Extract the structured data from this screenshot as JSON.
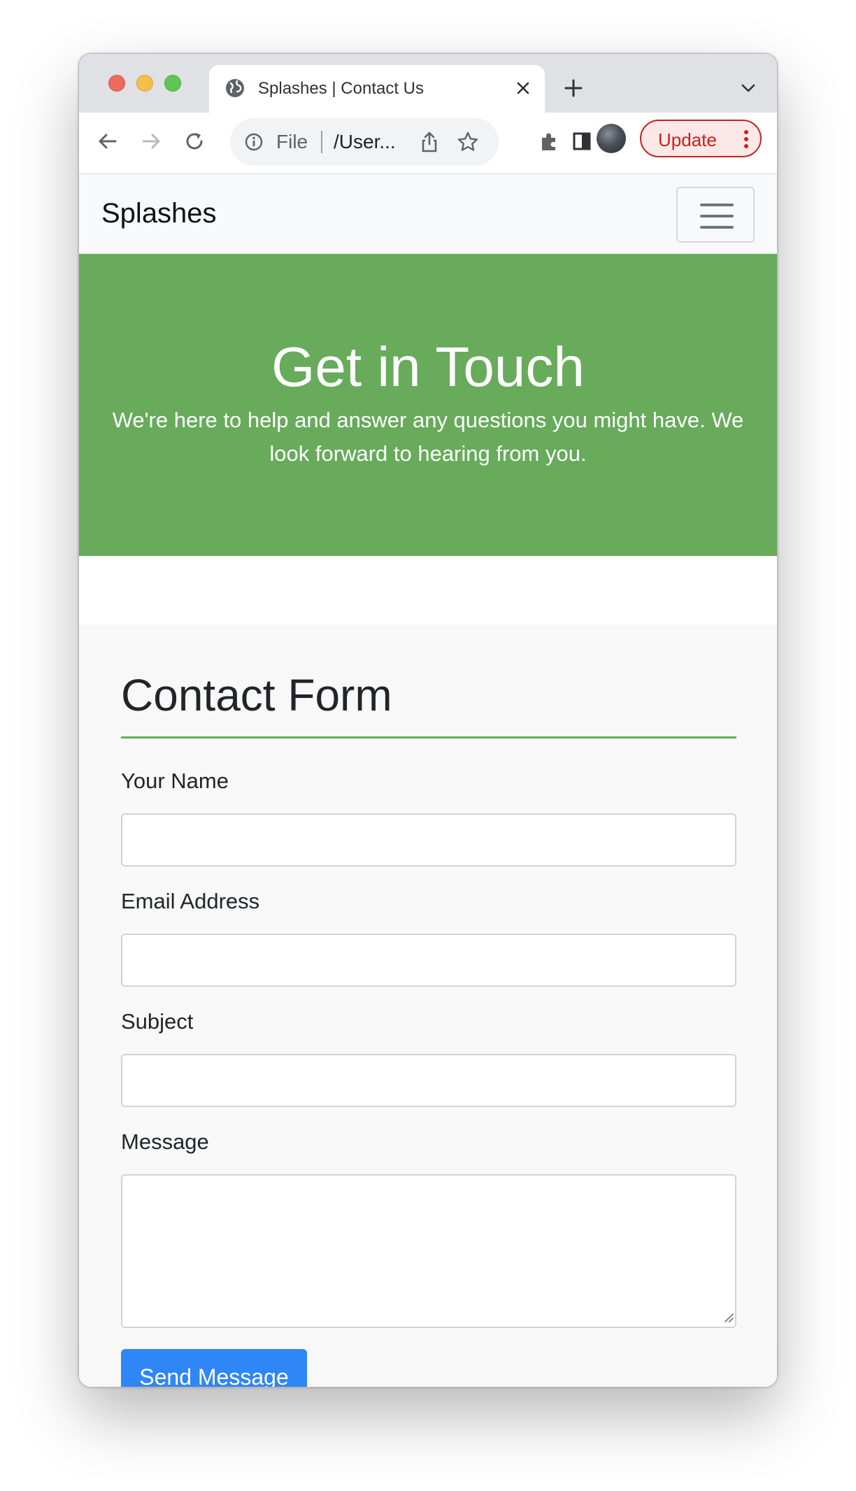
{
  "browser": {
    "tab_title": "Splashes | Contact Us",
    "omnibox": {
      "scheme_label": "File",
      "url": "/User..."
    },
    "update_label": "Update"
  },
  "navbar": {
    "brand": "Splashes"
  },
  "hero": {
    "title": "Get in Touch",
    "subtitle": "We're here to help and answer any questions you might have. We look forward to hearing from you."
  },
  "form": {
    "title": "Contact Form",
    "fields": [
      {
        "label": "Your Name",
        "value": ""
      },
      {
        "label": "Email Address",
        "value": ""
      },
      {
        "label": "Subject",
        "value": ""
      },
      {
        "label": "Message",
        "value": ""
      }
    ],
    "submit_label": "Send Message"
  },
  "colors": {
    "brand_green": "#67ab5b",
    "button_blue": "#2f86f6",
    "update_red": "#c5221f"
  }
}
